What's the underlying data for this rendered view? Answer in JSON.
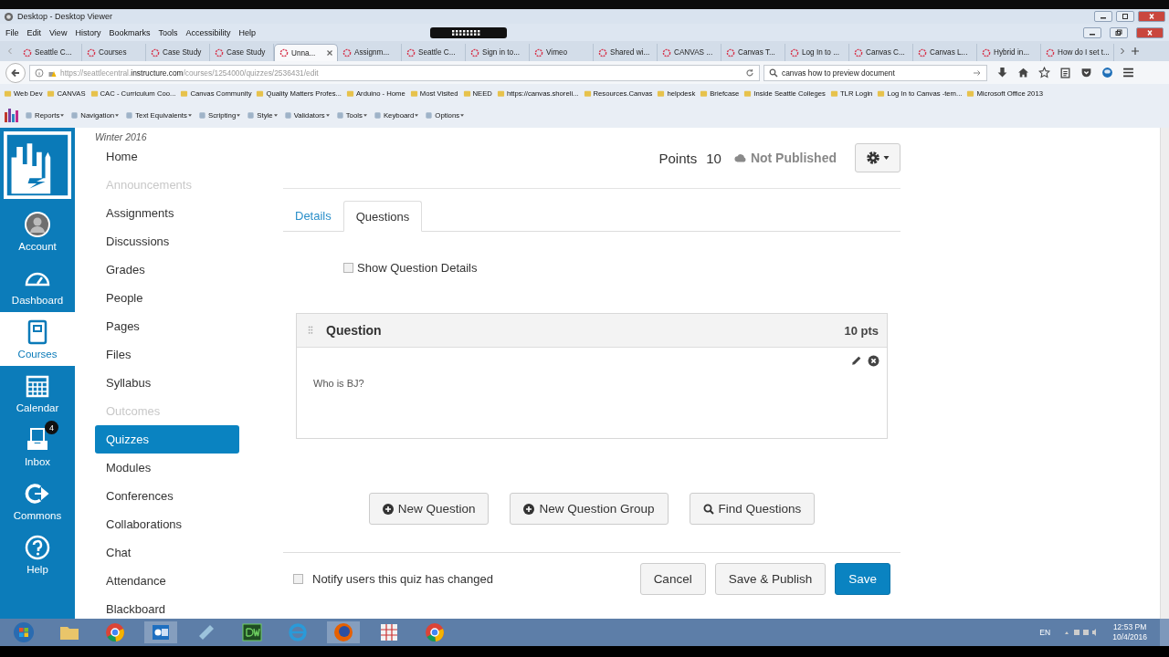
{
  "viewer": {
    "title": "Desktop - Desktop Viewer"
  },
  "menu": [
    "File",
    "Edit",
    "View",
    "History",
    "Bookmarks",
    "Tools",
    "Accessibility",
    "Help"
  ],
  "tabs": [
    {
      "label": "Seattle C...",
      "selected": false
    },
    {
      "label": "Courses",
      "selected": false
    },
    {
      "label": "Case Study",
      "selected": false
    },
    {
      "label": "Case Study",
      "selected": false
    },
    {
      "label": "Unna...",
      "selected": true
    },
    {
      "label": "Assignm...",
      "selected": false
    },
    {
      "label": "Seattle C...",
      "selected": false
    },
    {
      "label": "Sign in to...",
      "selected": false
    },
    {
      "label": "Vimeo",
      "selected": false
    },
    {
      "label": "Shared wi...",
      "selected": false
    },
    {
      "label": "CANVAS ...",
      "selected": false
    },
    {
      "label": "Canvas T...",
      "selected": false
    },
    {
      "label": "Log In to ...",
      "selected": false
    },
    {
      "label": "Canvas C...",
      "selected": false
    },
    {
      "label": "Canvas L...",
      "selected": false
    },
    {
      "label": "Hybrid in...",
      "selected": false
    },
    {
      "label": "How do I set t...",
      "selected": false
    }
  ],
  "address": {
    "url": "https://seattlecentral.**instructure.com**/courses/1254000/quizzes/2536431/edit"
  },
  "search": {
    "value": "canvas how to preview document"
  },
  "bookmarks": [
    "Web Dev",
    "CANVAS",
    "CAC - Curriculum Coo...",
    "Canvas Community",
    "Quality Matters Profes...",
    "Arduino - Home",
    "Most Visited",
    "NEED",
    "https://canvas.shoreli...",
    "Resources.Canvas",
    "helpdesk",
    "Briefcase",
    "Inside Seattle Colleges",
    "TLR Login",
    "Log In to Canvas -tem...",
    "Microsoft Office 2013"
  ],
  "toolbar": [
    "Reports",
    "Navigation",
    "Text Equivalents",
    "Scripting",
    "Style",
    "Validators",
    "Tools",
    "Keyboard",
    "Options"
  ],
  "global_nav": [
    {
      "label": "Account",
      "kind": "account",
      "selected": false
    },
    {
      "label": "Dashboard",
      "kind": "dashboard",
      "selected": false
    },
    {
      "label": "Courses",
      "kind": "courses",
      "selected": true
    },
    {
      "label": "Calendar",
      "kind": "calendar",
      "selected": false
    },
    {
      "label": "Inbox",
      "kind": "inbox",
      "selected": false,
      "badge": "4"
    },
    {
      "label": "Commons",
      "kind": "commons",
      "selected": false
    },
    {
      "label": "Help",
      "kind": "help",
      "selected": false
    }
  ],
  "course_nav": {
    "term": "Winter 2016",
    "items": [
      {
        "label": "Home",
        "disabled": false,
        "selected": false
      },
      {
        "label": "Announcements",
        "disabled": true,
        "selected": false
      },
      {
        "label": "Assignments",
        "disabled": false,
        "selected": false
      },
      {
        "label": "Discussions",
        "disabled": false,
        "selected": false
      },
      {
        "label": "Grades",
        "disabled": false,
        "selected": false
      },
      {
        "label": "People",
        "disabled": false,
        "selected": false
      },
      {
        "label": "Pages",
        "disabled": false,
        "selected": false
      },
      {
        "label": "Files",
        "disabled": false,
        "selected": false
      },
      {
        "label": "Syllabus",
        "disabled": false,
        "selected": false
      },
      {
        "label": "Outcomes",
        "disabled": true,
        "selected": false
      },
      {
        "label": "Quizzes",
        "disabled": false,
        "selected": true
      },
      {
        "label": "Modules",
        "disabled": false,
        "selected": false
      },
      {
        "label": "Conferences",
        "disabled": false,
        "selected": false
      },
      {
        "label": "Collaborations",
        "disabled": false,
        "selected": false
      },
      {
        "label": "Chat",
        "disabled": false,
        "selected": false
      },
      {
        "label": "Attendance",
        "disabled": false,
        "selected": false
      },
      {
        "label": "Blackboard",
        "disabled": false,
        "selected": false
      }
    ]
  },
  "quiz": {
    "points_label": "Points",
    "points": "10",
    "status": "Not Published",
    "published": false,
    "tabs": [
      {
        "label": "Details",
        "selected": false
      },
      {
        "label": "Questions",
        "selected": true
      }
    ],
    "show_details": {
      "label": "Show Question Details",
      "checked": false
    },
    "question": {
      "title": "Question",
      "points": "10 pts",
      "text": "Who is BJ?"
    },
    "actions": [
      {
        "label": "New Question",
        "kind": "add"
      },
      {
        "label": "New Question Group",
        "kind": "add"
      },
      {
        "label": "Find Questions",
        "kind": "search"
      }
    ],
    "notify": {
      "label": "Notify users this quiz has changed",
      "checked": false
    },
    "buttons": [
      {
        "label": "Cancel",
        "kind": "default"
      },
      {
        "label": "Save & Publish",
        "kind": "default"
      },
      {
        "label": "Save",
        "kind": "primary"
      }
    ]
  },
  "taskbar": {
    "language": "EN",
    "time": "12:53 PM",
    "date": "10/4/2016"
  }
}
